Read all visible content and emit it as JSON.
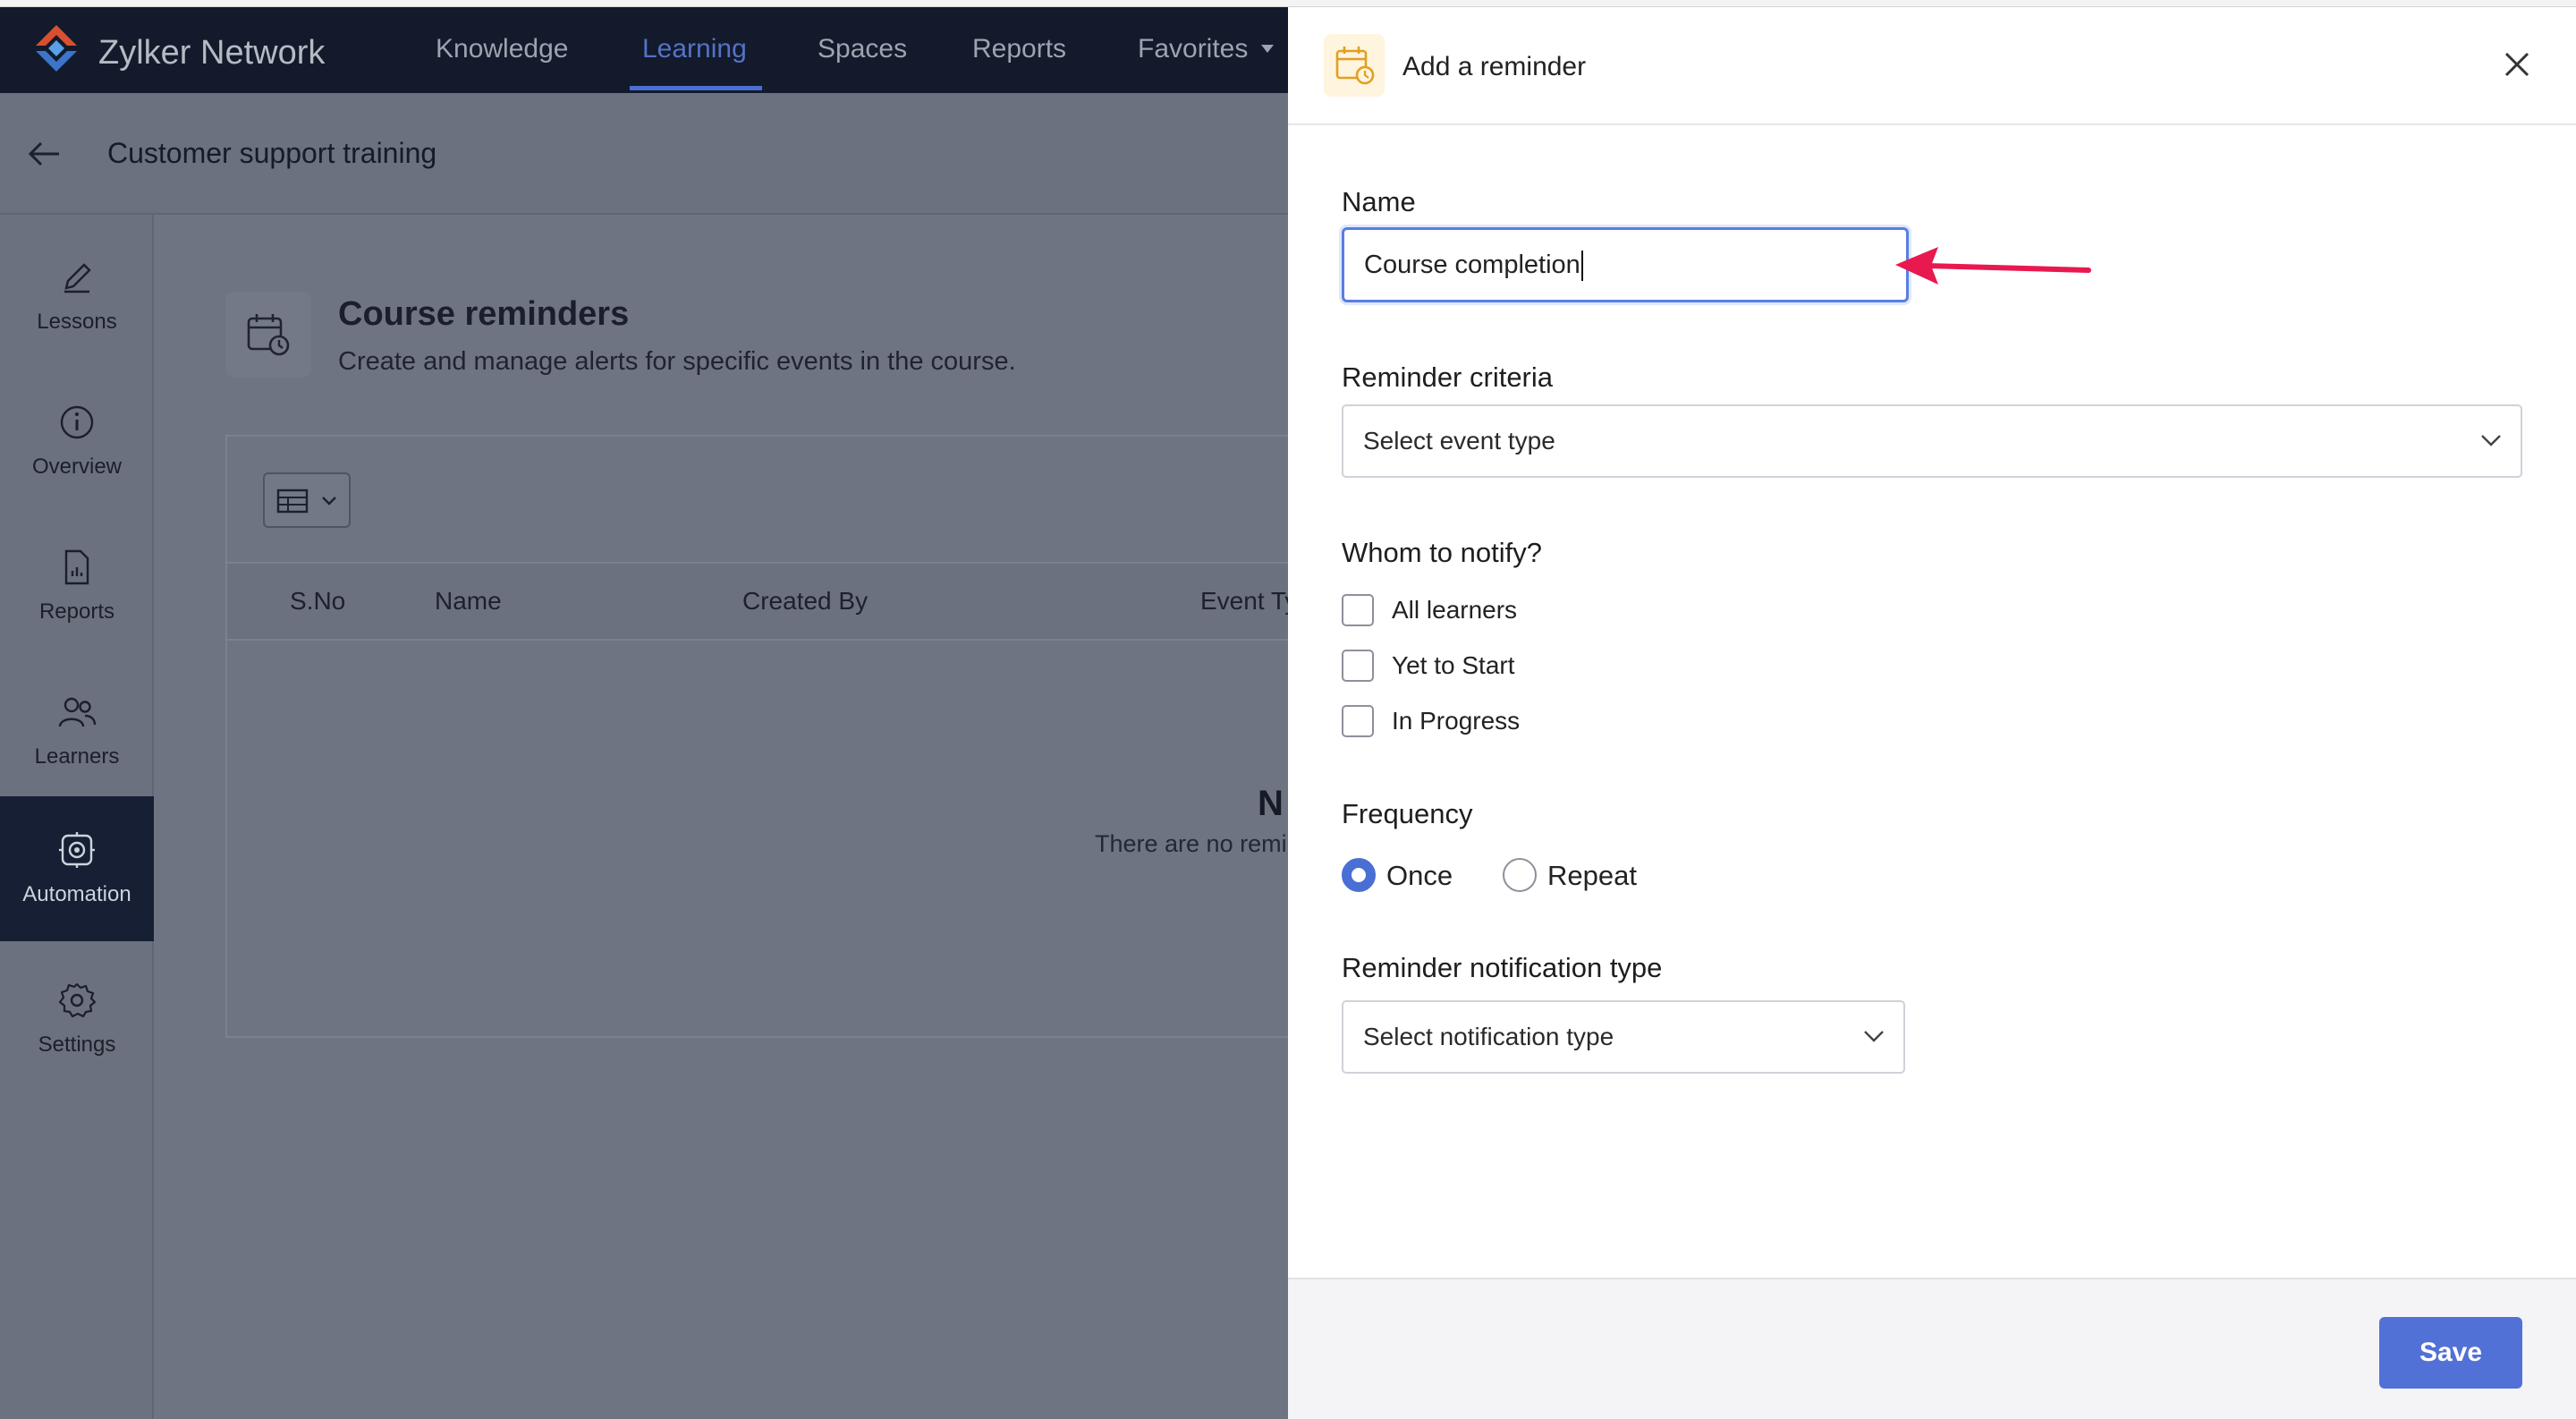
{
  "app": {
    "brand": "Zylker Network"
  },
  "nav": {
    "items": [
      {
        "label": "Knowledge",
        "active": false
      },
      {
        "label": "Learning",
        "active": true
      },
      {
        "label": "Spaces",
        "active": false
      },
      {
        "label": "Reports",
        "active": false
      },
      {
        "label": "Favorites",
        "active": false
      }
    ]
  },
  "page": {
    "title": "Customer support training"
  },
  "sidebar": {
    "items": [
      {
        "label": "Lessons",
        "icon": "pencil-icon"
      },
      {
        "label": "Overview",
        "icon": "info-icon"
      },
      {
        "label": "Reports",
        "icon": "report-icon"
      },
      {
        "label": "Learners",
        "icon": "users-icon"
      },
      {
        "label": "Automation",
        "icon": "automation-icon",
        "active": true
      },
      {
        "label": "Settings",
        "icon": "gear-icon"
      }
    ]
  },
  "reminders": {
    "title": "Course reminders",
    "subtitle": "Create and manage alerts for specific events in the course.",
    "columns": [
      "S.No",
      "Name",
      "Created By",
      "Event Ty"
    ],
    "empty_title": "N",
    "empty_subtitle": "There are no remi"
  },
  "panel": {
    "title": "Add a reminder",
    "name_label": "Name",
    "name_value": "Course completion",
    "criteria_label": "Reminder criteria",
    "criteria_placeholder": "Select event type",
    "notify_label": "Whom to notify?",
    "notify_options": [
      {
        "label": "All learners",
        "checked": false
      },
      {
        "label": "Yet to Start",
        "checked": false
      },
      {
        "label": "In Progress",
        "checked": false
      }
    ],
    "frequency_label": "Frequency",
    "frequency_options": [
      {
        "label": "Once",
        "selected": true
      },
      {
        "label": "Repeat",
        "selected": false
      }
    ],
    "notif_type_label": "Reminder notification type",
    "notif_type_placeholder": "Select notification type",
    "save_label": "Save"
  },
  "colors": {
    "accent": "#4a6fd4",
    "arrow": "#e8194f",
    "nav_bg": "#121a2b"
  }
}
